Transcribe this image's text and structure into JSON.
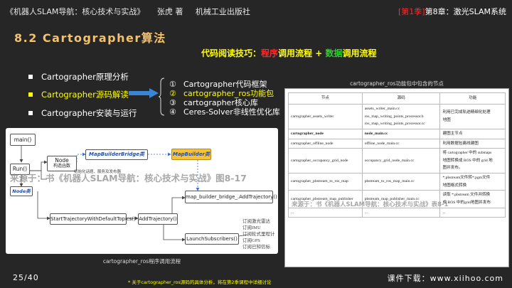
{
  "header": {
    "book_title": "《机器人SLAM导航：核心技术与实战》",
    "author": "张虎 著",
    "publisher": "机械工业出版社",
    "season": "[第1季]",
    "chapter": "第8章：激光SLAM系统"
  },
  "section_title": "8.2 Cartographer算法",
  "tip": {
    "prefix": "代码阅读技巧：",
    "part1": "程序",
    "mid": "调用流程 + ",
    "part2": "数据",
    "suffix": "调用流程"
  },
  "bullets": [
    {
      "label": "Cartographer原理分析"
    },
    {
      "label": "Cartographer源码解读"
    },
    {
      "label": "Cartographer安装与运行"
    }
  ],
  "sublist": [
    {
      "num": "①",
      "label": "Cartographer代码框架"
    },
    {
      "num": "②",
      "label": "cartographer_ros功能包"
    },
    {
      "num": "③",
      "label": "cartographer核心库"
    },
    {
      "num": "④",
      "label": "Ceres-Solver非线性优化库"
    }
  ],
  "table": {
    "title": "cartographer_ros功能包中包含的节点",
    "headers": [
      "节点",
      "源码",
      "功能"
    ],
    "rows": [
      {
        "node": "cartographer_assets_writer",
        "source": [
          "assets_writer_main.cc",
          "ros_map_writing_points_processor.h",
          "ros_map_writing_points_processor.cc"
        ],
        "func": [
          "利用已完成轨迹精细化处理",
          "地图"
        ],
        "bold": false
      },
      {
        "node": "cartographer_node",
        "source": [
          "node_main.cc"
        ],
        "func": [
          "建图主节点"
        ],
        "bold": true
      },
      {
        "node": "cartographer_offline_node",
        "source": [
          "offline_node_main.cc"
        ],
        "func": [
          "利用数据包离线建图"
        ],
        "bold": false
      },
      {
        "node": "cartographer_occupancy_grid_node",
        "source": [
          "occupancy_grid_node_main.cc"
        ],
        "func": [
          "将 cartographer 中的 submaps",
          "地图转换成 ROS 中的 grid 地",
          "图并发布。"
        ],
        "bold": false
      },
      {
        "node": "cartographer_pbstream_to_ros_map",
        "source": [
          "pbstream_to_ros_map_main.cc"
        ],
        "func": [
          "*.pbstream文件转*.pgm文件",
          "地图格式转换"
        ],
        "bold": false
      },
      {
        "node": "cartographer_pbstream_map_publisher",
        "source": [
          "pbstream_map_publisher_main.cc"
        ],
        "func": [
          "读取 *.pbstream 文件并转换",
          "成 ROS 中的grid地图并发布"
        ],
        "bold": false
      },
      {
        "node": "...",
        "source": [
          "..."
        ],
        "func": [
          "..."
        ],
        "bold": false
      }
    ]
  },
  "diagram": {
    "caption": "cartographer_ros程序调用流程",
    "main": "main()",
    "run": "Run()",
    "node_title": "Node",
    "node_sub": "构造函数",
    "node_class": "Node类",
    "mapbuilder_bridge": "MapBuilderBridge类",
    "mapbuilder": "MapBuilder类",
    "init_subs": "初始化话题、服务及发布器",
    "bridge_add": "map_builder_bridge_.AddTrajectory()",
    "start_traj": "StartTrajectoryWithDefaultTopics()",
    "add_traj": "AddTrajectory()",
    "launch_subs": "LaunchSubscribers()",
    "sub_labels": [
      "订阅激光雷达",
      "订阅IMU",
      "订阅轮式里程计",
      "订阅GPS",
      "订阅已知信标"
    ]
  },
  "watermarks": {
    "left": "来源于：书《机器人SLAM导航：核心技术与实战》图8-17",
    "right": "来源于：书《机器人SLAM导航：核心技术与实战》表8-1"
  },
  "footer": {
    "page": "25/40",
    "note": "* 关于cartographer_ros源码的具体分析，将在第2季课程中详细讨论",
    "download": "课件下载：www.xiihoo.com"
  }
}
